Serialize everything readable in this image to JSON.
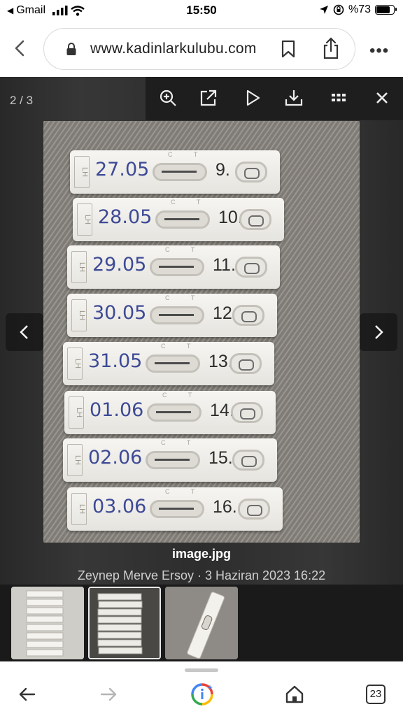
{
  "status": {
    "carrier": "Gmail",
    "time": "15:50",
    "battery": "%73"
  },
  "browser": {
    "url": "www.kadinlarkulubu.com",
    "open_tabs": "23"
  },
  "viewer": {
    "counter": "2 / 3",
    "image_title": "image.jpg",
    "meta": "Zeynep Merve Ersoy · 3 Haziran 2023 16:22",
    "toolbar_icons": [
      "zoom-in-icon",
      "open-external-icon",
      "play-icon",
      "download-icon",
      "grid-icon",
      "close-icon"
    ]
  },
  "photo": {
    "strips": [
      {
        "date": "27.05",
        "day": "9."
      },
      {
        "date": "28.05",
        "day": "10."
      },
      {
        "date": "29.05",
        "day": "11."
      },
      {
        "date": "30.05",
        "day": "12."
      },
      {
        "date": "31.05",
        "day": "13."
      },
      {
        "date": "01.06",
        "day": "14."
      },
      {
        "date": "02.06",
        "day": "15."
      },
      {
        "date": "03.06",
        "day": "16."
      }
    ],
    "strip_label": "LH",
    "window_label": "C T"
  },
  "colors": {
    "viewer_bg": "#1b1b1b",
    "ink": "#3d4a96"
  }
}
